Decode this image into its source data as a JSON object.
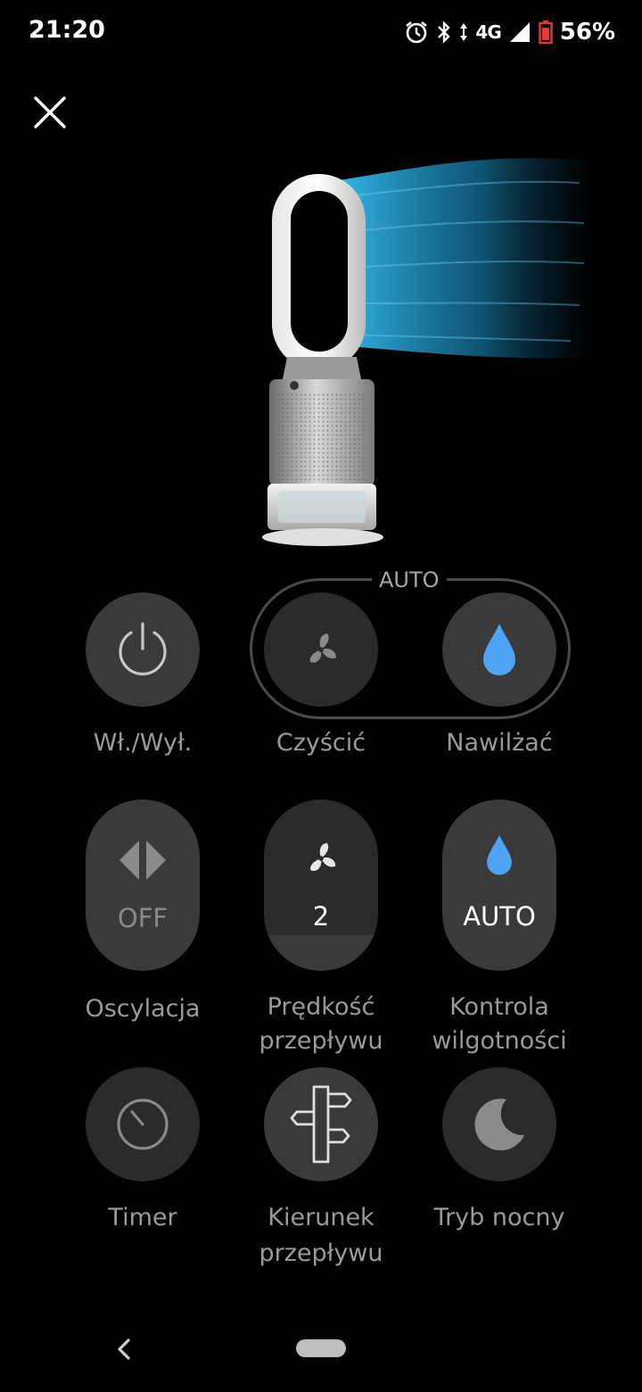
{
  "status_bar": {
    "time": "21:20",
    "network": "4G",
    "battery": "56%",
    "icons": [
      "alarm-icon",
      "bluetooth-icon",
      "data-arrows-icon",
      "signal-icon",
      "battery-icon"
    ]
  },
  "header": {
    "close_icon": "close-icon"
  },
  "colors": {
    "background": "#000000",
    "button": "#3a3a3a",
    "accent_blue": "#4ea3f5",
    "label": "#9a9a9a",
    "airflow": "#2aa8d8"
  },
  "controls": {
    "auto_group_label": "AUTO",
    "power": {
      "label": "Wł./Wył.",
      "icon": "power-icon"
    },
    "purify": {
      "label": "Czyścić",
      "icon": "fan-icon"
    },
    "humidify": {
      "label": "Nawilżać",
      "icon": "water-drop-icon"
    },
    "oscillation": {
      "label_line1": "Oscylacja",
      "value": "OFF",
      "icon": "oscillation-icon"
    },
    "airflow_speed": {
      "label_line1": "Prędkość",
      "label_line2": "przepływu",
      "value": "2",
      "icon": "fan-icon"
    },
    "humidity_control": {
      "label_line1": "Kontrola",
      "label_line2": "wilgotności",
      "value": "AUTO",
      "icon": "water-drop-icon"
    },
    "timer": {
      "label": "Timer",
      "icon": "timer-icon"
    },
    "airflow_direction": {
      "label_line1": "Kierunek",
      "label_line2": "przepływu",
      "icon": "signpost-icon"
    },
    "night_mode": {
      "label": "Tryb nocny",
      "icon": "moon-icon"
    }
  },
  "nav_bar": {
    "back_icon": "back-chevron-icon",
    "home_icon": "home-pill-icon"
  }
}
